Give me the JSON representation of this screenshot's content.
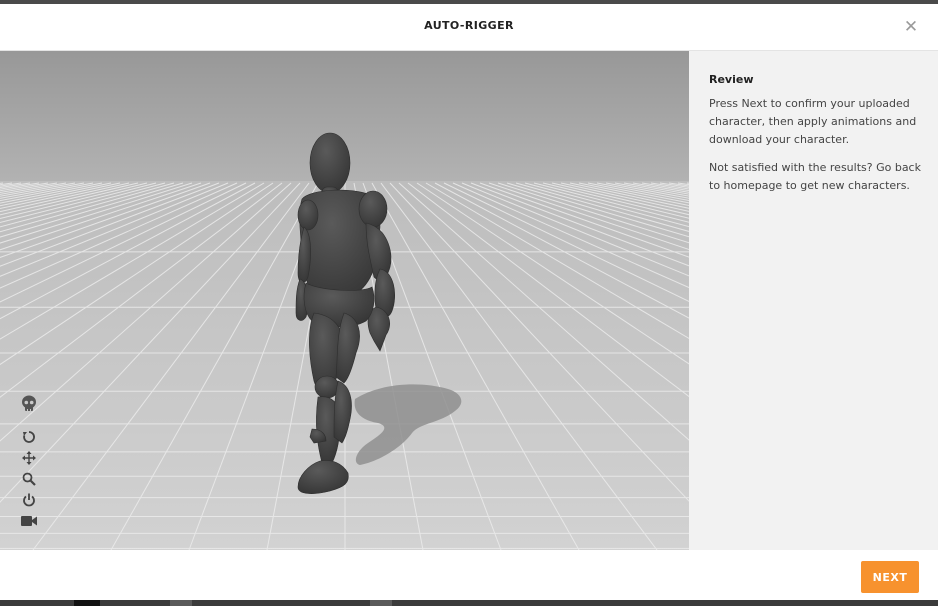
{
  "header": {
    "title": "AUTO-RIGGER",
    "close_icon": "close-icon"
  },
  "viewport": {
    "tools": [
      "skull-icon",
      "rotate-icon",
      "move-icon",
      "zoom-icon",
      "power-icon",
      "camera-icon"
    ],
    "colors": {
      "floor": "#c9c9c9",
      "sky": "#9d9d9d",
      "character": "#4a4a4a"
    }
  },
  "panel": {
    "heading": "Review",
    "paragraph1": "Press Next to confirm your uploaded character, then apply animations and download your character.",
    "paragraph2": "Not satisfied with the results? Go back to homepage to get new characters."
  },
  "footer": {
    "next_label": "NEXT"
  },
  "colors": {
    "accent": "#f7922e"
  }
}
